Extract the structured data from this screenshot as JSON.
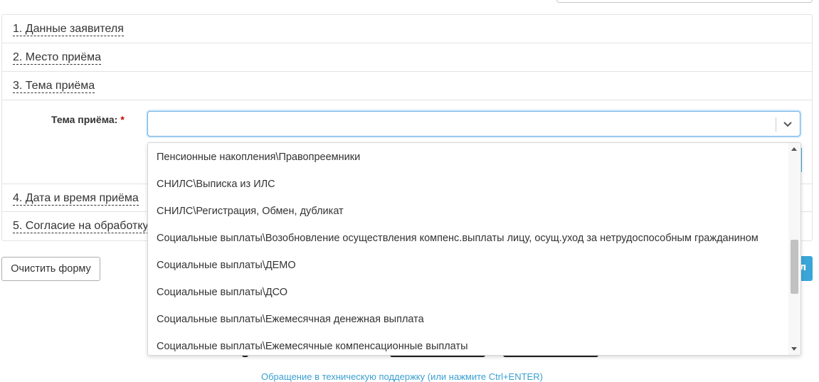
{
  "sections": [
    {
      "label": "1. Данные заявителя"
    },
    {
      "label": "2. Место приёма"
    },
    {
      "label": "3. Тема приёма"
    },
    {
      "label": "4. Дата и время приёма"
    },
    {
      "label": "5. Согласие на обработку"
    }
  ],
  "topic_field": {
    "label": "Тема приёма:",
    "required_mark": "*",
    "value": ""
  },
  "dropdown": {
    "options": [
      "Пенсионные накопления\\Правопреемники",
      "СНИЛС\\Выписка из ИЛС",
      "СНИЛС\\Регистрация, Обмен, дубликат",
      "Социальные выплаты\\Возобновление осуществления компенс.выплаты лицу, осущ.уход за нетрудоспособным гражданином",
      "Социальные выплаты\\ДЕМО",
      "Социальные выплаты\\ДСО",
      "Социальные выплаты\\Ежемесячная денежная выплата",
      "Социальные выплаты\\Ежемесячные компенсационные выплаты"
    ]
  },
  "buttons": {
    "clear_form": "Очистить форму",
    "submit_partial": "л"
  },
  "footer": {
    "support_link": "Обращение в техническую поддержку (или нажмите Ctrl+ENTER)"
  },
  "colors": {
    "accent": "#3aa5d8",
    "focus_border": "#66afe9",
    "link": "#3b9fd1",
    "required": "#cc0000"
  }
}
